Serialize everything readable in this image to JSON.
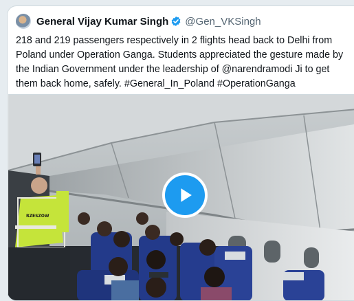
{
  "tweet": {
    "display_name": "General Vijay Kumar Singh",
    "handle": "@Gen_VKSingh",
    "text": "218 and 219 passengers respectively in 2 flights head back to Delhi from Poland under Operation Ganga. Students appreciated the gesture made by the Indian Government under the leadership of @narendramodi Ji to get them back home, safely. #General_In_Poland #OperationGanga"
  },
  "media": {
    "vest_text": "RZESZOW",
    "icons": {
      "verified": "verified-badge-icon",
      "play": "play-icon"
    }
  },
  "colors": {
    "accent": "#1d9bf0",
    "text": "#0f1419",
    "muted": "#536471"
  }
}
